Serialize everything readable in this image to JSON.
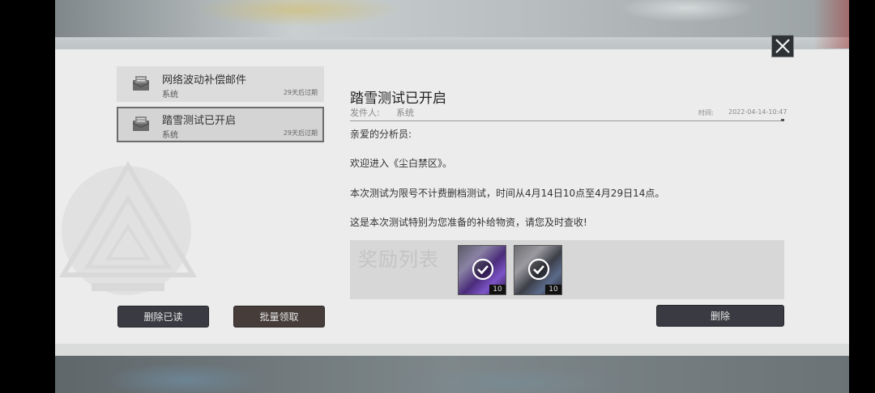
{
  "mail_list": [
    {
      "title": "网络波动补偿邮件",
      "sender": "系统",
      "expire": "29天后过期",
      "selected": false
    },
    {
      "title": "踏雪测试已开启",
      "sender": "系统",
      "expire": "29天后过期",
      "selected": true
    }
  ],
  "buttons": {
    "delete_read": "删除已读",
    "batch_claim": "批量领取",
    "delete": "删除"
  },
  "detail": {
    "title": "踏雪测试已开启",
    "sender_label": "发件人:",
    "sender": "系统",
    "time_label": "时间:",
    "time": "2022-04-14-10:47",
    "body": [
      "亲爱的分析员:",
      "欢迎进入《尘白禁区》。",
      "本次测试为限号不计费删档测试，时间从4月14日10点至4月29日14点。",
      "这是本次测试特别为您准备的补给物资，请您及时查收!"
    ]
  },
  "rewards": {
    "label": "奖励列表",
    "items": [
      {
        "count": "10",
        "claimed": true,
        "icon": "purple-card-icon"
      },
      {
        "count": "10",
        "claimed": true,
        "icon": "blue-card-icon"
      }
    ]
  },
  "colors": {
    "panel": "#ececec",
    "button_dark": "#3a3b42",
    "button_brown": "#463d3b"
  }
}
